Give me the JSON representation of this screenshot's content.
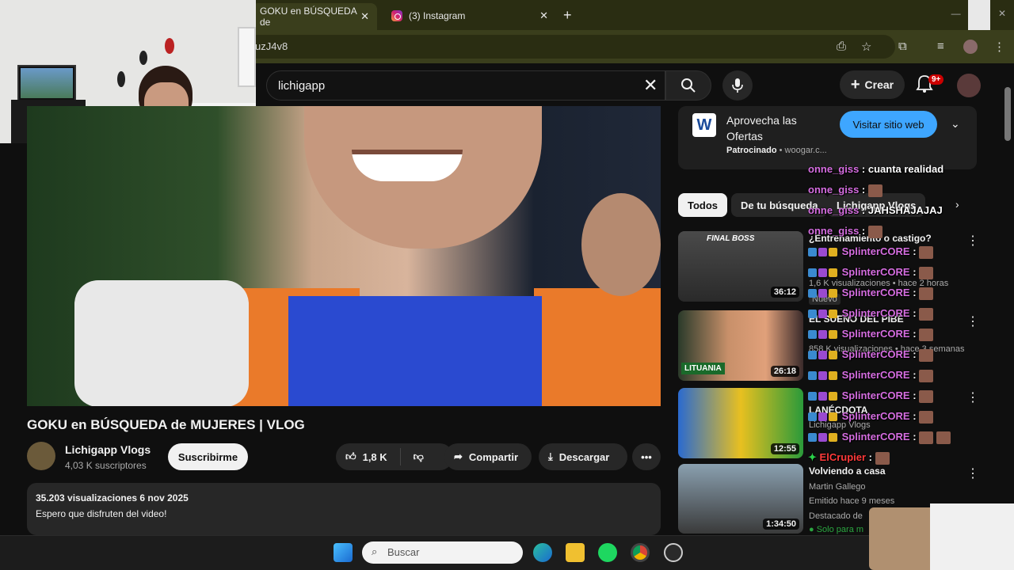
{
  "browser": {
    "tabs": [
      {
        "title": "GOKU en BÚSQUEDA de",
        "active": true
      },
      {
        "title": "(3) Instagram",
        "active": false
      }
    ],
    "new_tab": "+",
    "url_fragment": "uzJ4v8"
  },
  "youtube": {
    "search_value": "lichigapp",
    "create_label": "Crear",
    "notifications_badge": "9+",
    "video": {
      "title": "GOKU en BÚSQUEDA de MUJERES | VLOG",
      "channel": "Lichigapp Vlogs",
      "subscribers": "4,03 K suscriptores",
      "subscribe_label": "Suscribirme",
      "likes": "1,8 K",
      "share_label": "Compartir",
      "download_label": "Descargar",
      "views_date": "35.203 visualizaciones  6 nov 2025",
      "description": "Espero que disfruten del video!"
    },
    "ad": {
      "title": "Aprovecha las Ofertas",
      "sponsored": "Patrocinado",
      "domain": " • woogar.c...",
      "cta": "Visitar sitio web"
    },
    "chips": [
      "Todos",
      "De tu búsqueda",
      "Lichigapp Vlogs"
    ],
    "related": [
      {
        "title": "¿Entrenamiento o castigo?",
        "meta": "1,6 K visualizaciones • hace 2 horas",
        "duration": "36:12",
        "badge": "Nuevo"
      },
      {
        "title": "EL SUEÑO DEL PIBE",
        "meta": "858 K visualizaciones • hace 3 semanas",
        "duration": "26:18"
      },
      {
        "title": "LANÉCDOTA",
        "meta": "Lichigapp Vlogs",
        "duration": "12:55"
      },
      {
        "title": "Volviendo a casa",
        "meta": "Martin Gallego",
        "meta2": "Emitido hace 9 meses",
        "meta3": "Destacado de",
        "duration": "1:34:50",
        "members": "Solo para m"
      }
    ]
  },
  "chat": [
    {
      "user": "onne_giss",
      "text": ": cuanta realidad"
    },
    {
      "user": "onne_giss",
      "text": ":"
    },
    {
      "user": "onne_giss",
      "text": ": JAHSHAJAJAJ"
    },
    {
      "user": "onne_giss",
      "text": ":"
    },
    {
      "user": "SplinterCORE",
      "text": ":"
    },
    {
      "user": "SplinterCORE",
      "text": ":"
    },
    {
      "user": "SplinterCORE",
      "text": ":"
    },
    {
      "user": "SplinterCORE",
      "text": ":"
    },
    {
      "user": "SplinterCORE",
      "text": ":"
    },
    {
      "user": "SplinterCORE",
      "text": ":"
    },
    {
      "user": "SplinterCORE",
      "text": ":"
    },
    {
      "user": "SplinterCORE",
      "text": ":"
    },
    {
      "user": "SplinterCORE",
      "text": ":"
    },
    {
      "user": "SplinterCORE",
      "text": ":"
    },
    {
      "user": "ElCrupier",
      "text": ":"
    }
  ],
  "taskbar": {
    "search_placeholder": "Buscar"
  },
  "colors": {
    "accent_blue": "#3ea6ff",
    "chrome_bg": "#3a3e1c",
    "chat_user": "#d56de0",
    "chat_user_alt": "#ff3a3a"
  }
}
